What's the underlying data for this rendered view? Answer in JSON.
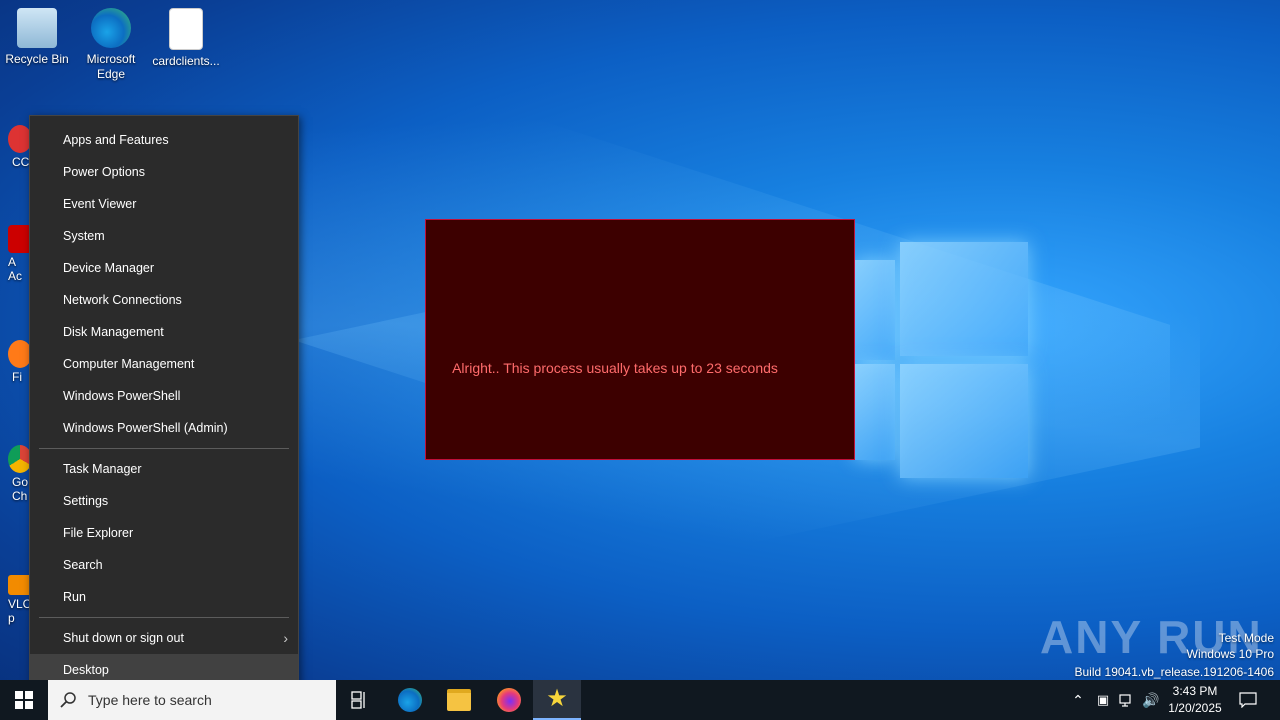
{
  "desktop": {
    "icons": [
      {
        "label": "Recycle Bin"
      },
      {
        "label": "Microsoft Edge"
      },
      {
        "label": "cardclients..."
      }
    ],
    "partial_icons": [
      {
        "label": "CC"
      },
      {
        "label": "A Ac"
      },
      {
        "label": "Fi"
      },
      {
        "label": "Go Ch"
      },
      {
        "label": "VLC p"
      }
    ]
  },
  "context_menu": {
    "group1": [
      "Apps and Features",
      "Power Options",
      "Event Viewer",
      "System",
      "Device Manager",
      "Network Connections",
      "Disk Management",
      "Computer Management",
      "Windows PowerShell",
      "Windows PowerShell (Admin)"
    ],
    "group2": [
      "Task Manager",
      "Settings",
      "File Explorer",
      "Search",
      "Run"
    ],
    "group3": [
      "Shut down or sign out",
      "Desktop"
    ]
  },
  "dialog": {
    "message": "Alright.. This process usually takes up to 23 seconds"
  },
  "watermark": {
    "brand": "ANY RUN",
    "test_mode": "Test Mode",
    "edition": "Windows 10 Pro",
    "build": "Build 19041.vb_release.191206-1406"
  },
  "taskbar": {
    "search_placeholder": "Type here to search",
    "time": "3:43 PM",
    "date": "1/20/2025"
  },
  "colors": {
    "dialog_bg": "#3d0000",
    "dialog_text": "#ff6b6b",
    "menu_bg": "#2b2b2b",
    "taskbar_bg": "#101820"
  }
}
